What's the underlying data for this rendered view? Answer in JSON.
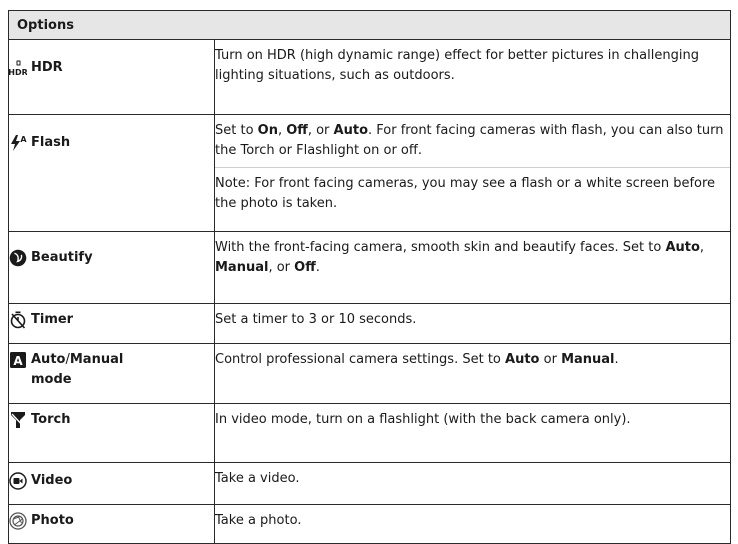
{
  "header": {
    "title": "Options"
  },
  "rows": {
    "hdr": {
      "icon": "hdr-icon",
      "name": "HDR",
      "desc": "Turn on HDR (high dynamic range) effect for better pictures in challenging lighting situations, such as outdoors."
    },
    "flash": {
      "icon": "flash-auto-icon",
      "name": "Flash",
      "desc_a": "Set to ",
      "on": "On",
      "desc_b": ", ",
      "off": "Off",
      "desc_c": ", or ",
      "auto": "Auto",
      "desc_d": ".  For front facing cameras with flash, you can also turn the Torch or Flashlight on or off.",
      "note": "Note: For front facing cameras, you may see a flash or a white screen before the photo is taken."
    },
    "beautify": {
      "icon": "beautify-face-icon",
      "name": "Beautify",
      "desc_a": "With the front-facing camera, smooth skin and beautify faces. Set to ",
      "auto": "Auto",
      "desc_b": ", ",
      "manual": "Manual",
      "desc_c": ", or ",
      "off": "Off",
      "desc_d": "."
    },
    "timer": {
      "icon": "timer-icon",
      "name": "Timer",
      "desc": "Set a timer to 3 or 10 seconds."
    },
    "mode": {
      "icon": "auto-mode-icon",
      "name_a": "Auto",
      "slash": "/",
      "name_b": "Manual",
      "name_c": "mode",
      "desc_a": "Control professional camera settings. Set to ",
      "auto": "Auto",
      "desc_b": " or ",
      "manual": "Manual",
      "desc_c": "."
    },
    "torch": {
      "icon": "torch-icon",
      "name": "Torch",
      "desc": "In video mode, turn on a flashlight (with the back camera only)."
    },
    "video": {
      "icon": "video-record-icon",
      "name": "Video",
      "desc": "Take a video."
    },
    "photo": {
      "icon": "photo-shutter-icon",
      "name": "Photo",
      "desc": "Take a photo."
    }
  }
}
